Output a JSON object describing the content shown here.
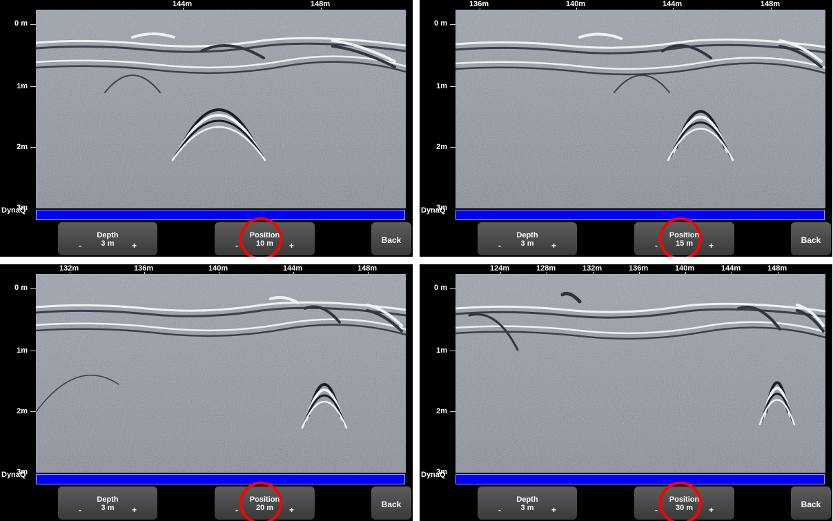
{
  "colors": {
    "scan_base": "#8f95a2",
    "dynaq_bar": "#0000ff",
    "highlight_circle": "#ff0000",
    "button_top": "#5c5c5c",
    "button_bottom": "#3a3a3a"
  },
  "panels": [
    {
      "ruler_ticks": [
        "144m",
        "148m"
      ],
      "depth_labels": [
        "0 m",
        "1m",
        "2m",
        "3m"
      ],
      "dynaq_label": "DynaQ",
      "depth_button": {
        "title": "Depth",
        "value": "3 m",
        "minus": "-",
        "plus": "+"
      },
      "position_button": {
        "title": "Position",
        "value": "10 m",
        "minus": "-",
        "plus": "+"
      },
      "back_button": {
        "label": "Back"
      }
    },
    {
      "ruler_ticks": [
        "136m",
        "140m",
        "144m",
        "148m"
      ],
      "depth_labels": [
        "0 m",
        "1m",
        "2m",
        "3m"
      ],
      "dynaq_label": "DynaQ",
      "depth_button": {
        "title": "Depth",
        "value": "3 m",
        "minus": "-",
        "plus": "+"
      },
      "position_button": {
        "title": "Position",
        "value": "15 m",
        "minus": "-",
        "plus": "+"
      },
      "back_button": {
        "label": "Back"
      }
    },
    {
      "ruler_ticks": [
        "132m",
        "136m",
        "140m",
        "144m",
        "148m"
      ],
      "depth_labels": [
        "0 m",
        "1m",
        "2m",
        "3m"
      ],
      "dynaq_label": "DynaQ",
      "depth_button": {
        "title": "Depth",
        "value": "3 m",
        "minus": "-",
        "plus": "+"
      },
      "position_button": {
        "title": "Position",
        "value": "20 m",
        "minus": "-",
        "plus": "+"
      },
      "back_button": {
        "label": "Back"
      }
    },
    {
      "ruler_ticks": [
        "124m",
        "128m",
        "132m",
        "136m",
        "140m",
        "144m",
        "148m"
      ],
      "depth_labels": [
        "0 m",
        "1m",
        "2m",
        "3m"
      ],
      "dynaq_label": "DynaQ",
      "depth_button": {
        "title": "Depth",
        "value": "3 m",
        "minus": "-",
        "plus": "+"
      },
      "position_button": {
        "title": "Position",
        "value": "30 m",
        "minus": "-",
        "plus": "+"
      },
      "back_button": {
        "label": "Back"
      }
    }
  ]
}
